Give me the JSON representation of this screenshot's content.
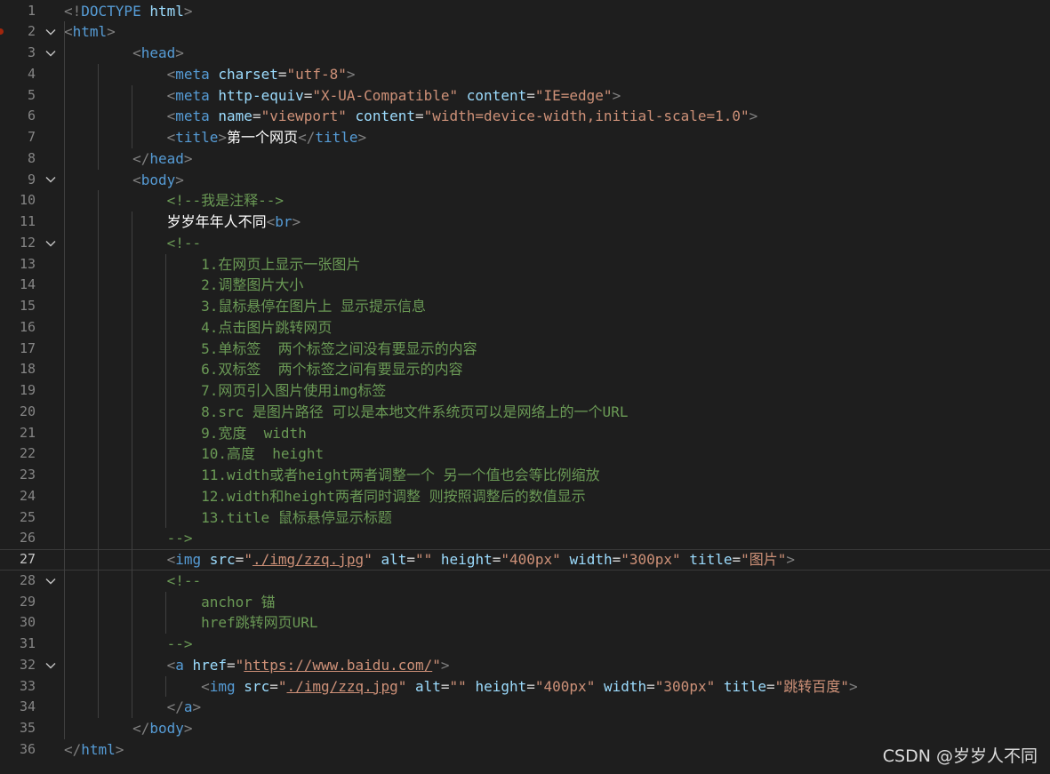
{
  "colors": {
    "background": "#1e1e1e",
    "line_number": "#858585",
    "active_line_number": "#c6c6c6",
    "punctuation": "#808080",
    "tag": "#569cd6",
    "attribute": "#9cdcfe",
    "string": "#ce9178",
    "comment": "#6a9955",
    "text": "#ffffff",
    "indent_guide": "#404040"
  },
  "editor": {
    "active_line": 27,
    "lines": [
      {
        "n": "1",
        "fold": false,
        "tokens": [
          [
            "p",
            "<!"
          ],
          [
            "t",
            "DOCTYPE "
          ],
          [
            "a",
            "html"
          ],
          [
            "p",
            ">"
          ]
        ]
      },
      {
        "n": "2",
        "fold": true,
        "tokens": [
          [
            "p",
            "<"
          ],
          [
            "t",
            "html"
          ],
          [
            "p",
            ">"
          ]
        ]
      },
      {
        "n": "3",
        "fold": true,
        "tokens": [
          [
            "w",
            "        "
          ],
          [
            "p",
            "<"
          ],
          [
            "t",
            "head"
          ],
          [
            "p",
            ">"
          ]
        ]
      },
      {
        "n": "4",
        "fold": false,
        "tokens": [
          [
            "w",
            "            "
          ],
          [
            "p",
            "<"
          ],
          [
            "t",
            "meta "
          ],
          [
            "a",
            "charset"
          ],
          [
            "w",
            "="
          ],
          [
            "s",
            "\"utf-8\""
          ],
          [
            "p",
            ">"
          ]
        ]
      },
      {
        "n": "5",
        "fold": false,
        "tokens": [
          [
            "w",
            "            "
          ],
          [
            "p",
            "<"
          ],
          [
            "t",
            "meta "
          ],
          [
            "a",
            "http-equiv"
          ],
          [
            "w",
            "="
          ],
          [
            "s",
            "\"X-UA-Compatible\""
          ],
          [
            "w",
            " "
          ],
          [
            "a",
            "content"
          ],
          [
            "w",
            "="
          ],
          [
            "s",
            "\"IE=edge\""
          ],
          [
            "p",
            ">"
          ]
        ]
      },
      {
        "n": "6",
        "fold": false,
        "tokens": [
          [
            "w",
            "            "
          ],
          [
            "p",
            "<"
          ],
          [
            "t",
            "meta "
          ],
          [
            "a",
            "name"
          ],
          [
            "w",
            "="
          ],
          [
            "s",
            "\"viewport\""
          ],
          [
            "w",
            " "
          ],
          [
            "a",
            "content"
          ],
          [
            "w",
            "="
          ],
          [
            "s",
            "\"width=device-width,initial-scale=1.0\""
          ],
          [
            "p",
            ">"
          ]
        ]
      },
      {
        "n": "7",
        "fold": false,
        "tokens": [
          [
            "w",
            "            "
          ],
          [
            "p",
            "<"
          ],
          [
            "t",
            "title"
          ],
          [
            "p",
            ">"
          ],
          [
            "x",
            "第一个网页"
          ],
          [
            "p",
            "</"
          ],
          [
            "t",
            "title"
          ],
          [
            "p",
            ">"
          ]
        ]
      },
      {
        "n": "8",
        "fold": false,
        "tokens": [
          [
            "w",
            "        "
          ],
          [
            "p",
            "</"
          ],
          [
            "t",
            "head"
          ],
          [
            "p",
            ">"
          ]
        ]
      },
      {
        "n": "9",
        "fold": true,
        "tokens": [
          [
            "w",
            "        "
          ],
          [
            "p",
            "<"
          ],
          [
            "t",
            "body"
          ],
          [
            "p",
            ">"
          ]
        ]
      },
      {
        "n": "10",
        "fold": false,
        "tokens": [
          [
            "w",
            "            "
          ],
          [
            "c",
            "<!--我是注释-->"
          ]
        ]
      },
      {
        "n": "11",
        "fold": false,
        "tokens": [
          [
            "w",
            "            "
          ],
          [
            "x",
            "岁岁年年人不同"
          ],
          [
            "p",
            "<"
          ],
          [
            "t",
            "br"
          ],
          [
            "p",
            ">"
          ]
        ]
      },
      {
        "n": "12",
        "fold": true,
        "tokens": [
          [
            "w",
            "            "
          ],
          [
            "c",
            "<!--"
          ]
        ]
      },
      {
        "n": "13",
        "fold": false,
        "tokens": [
          [
            "w",
            "                "
          ],
          [
            "c",
            "1.在网页上显示一张图片"
          ]
        ]
      },
      {
        "n": "14",
        "fold": false,
        "tokens": [
          [
            "w",
            "                "
          ],
          [
            "c",
            "2.调整图片大小"
          ]
        ]
      },
      {
        "n": "15",
        "fold": false,
        "tokens": [
          [
            "w",
            "                "
          ],
          [
            "c",
            "3.鼠标悬停在图片上 显示提示信息"
          ]
        ]
      },
      {
        "n": "16",
        "fold": false,
        "tokens": [
          [
            "w",
            "                "
          ],
          [
            "c",
            "4.点击图片跳转网页"
          ]
        ]
      },
      {
        "n": "17",
        "fold": false,
        "tokens": [
          [
            "w",
            "                "
          ],
          [
            "c",
            "5.单标签  两个标签之间没有要显示的内容"
          ]
        ]
      },
      {
        "n": "18",
        "fold": false,
        "tokens": [
          [
            "w",
            "                "
          ],
          [
            "c",
            "6.双标签  两个标签之间有要显示的内容"
          ]
        ]
      },
      {
        "n": "19",
        "fold": false,
        "tokens": [
          [
            "w",
            "                "
          ],
          [
            "c",
            "7.网页引入图片使用img标签"
          ]
        ]
      },
      {
        "n": "20",
        "fold": false,
        "tokens": [
          [
            "w",
            "                "
          ],
          [
            "c",
            "8.src 是图片路径 可以是本地文件系统页可以是网络上的一个URL"
          ]
        ]
      },
      {
        "n": "21",
        "fold": false,
        "tokens": [
          [
            "w",
            "                "
          ],
          [
            "c",
            "9.宽度  width"
          ]
        ]
      },
      {
        "n": "22",
        "fold": false,
        "tokens": [
          [
            "w",
            "                "
          ],
          [
            "c",
            "10.高度  height"
          ]
        ]
      },
      {
        "n": "23",
        "fold": false,
        "tokens": [
          [
            "w",
            "                "
          ],
          [
            "c",
            "11.width或者height两者调整一个 另一个值也会等比例缩放"
          ]
        ]
      },
      {
        "n": "24",
        "fold": false,
        "tokens": [
          [
            "w",
            "                "
          ],
          [
            "c",
            "12.width和height两者同时调整 则按照调整后的数值显示"
          ]
        ]
      },
      {
        "n": "25",
        "fold": false,
        "tokens": [
          [
            "w",
            "                "
          ],
          [
            "c",
            "13.title 鼠标悬停显示标题"
          ]
        ]
      },
      {
        "n": "26",
        "fold": false,
        "tokens": [
          [
            "w",
            "            "
          ],
          [
            "c",
            "-->"
          ]
        ]
      },
      {
        "n": "27",
        "fold": false,
        "tokens": [
          [
            "w",
            "            "
          ],
          [
            "p",
            "<"
          ],
          [
            "t",
            "img "
          ],
          [
            "a",
            "src"
          ],
          [
            "w",
            "="
          ],
          [
            "s",
            "\""
          ],
          [
            "u",
            "./img/zzq.jpg"
          ],
          [
            "s",
            "\""
          ],
          [
            "w",
            " "
          ],
          [
            "a",
            "alt"
          ],
          [
            "w",
            "="
          ],
          [
            "s",
            "\"\""
          ],
          [
            "w",
            " "
          ],
          [
            "a",
            "height"
          ],
          [
            "w",
            "="
          ],
          [
            "s",
            "\"400px\""
          ],
          [
            "w",
            " "
          ],
          [
            "a",
            "width"
          ],
          [
            "w",
            "="
          ],
          [
            "s",
            "\"300px\""
          ],
          [
            "w",
            " "
          ],
          [
            "a",
            "title"
          ],
          [
            "w",
            "="
          ],
          [
            "s",
            "\"图片\""
          ],
          [
            "p",
            ">"
          ]
        ]
      },
      {
        "n": "28",
        "fold": true,
        "tokens": [
          [
            "w",
            "            "
          ],
          [
            "c",
            "<!--"
          ]
        ]
      },
      {
        "n": "29",
        "fold": false,
        "tokens": [
          [
            "w",
            "                "
          ],
          [
            "c",
            "anchor 锚"
          ]
        ]
      },
      {
        "n": "30",
        "fold": false,
        "tokens": [
          [
            "w",
            "                "
          ],
          [
            "c",
            "href跳转网页URL"
          ]
        ]
      },
      {
        "n": "31",
        "fold": false,
        "tokens": [
          [
            "w",
            "            "
          ],
          [
            "c",
            "-->"
          ]
        ]
      },
      {
        "n": "32",
        "fold": true,
        "tokens": [
          [
            "w",
            "            "
          ],
          [
            "p",
            "<"
          ],
          [
            "t",
            "a "
          ],
          [
            "a",
            "href"
          ],
          [
            "w",
            "="
          ],
          [
            "s",
            "\""
          ],
          [
            "u",
            "https://www.baidu.com/"
          ],
          [
            "s",
            "\""
          ],
          [
            "p",
            ">"
          ]
        ]
      },
      {
        "n": "33",
        "fold": false,
        "tokens": [
          [
            "w",
            "                "
          ],
          [
            "p",
            "<"
          ],
          [
            "t",
            "img "
          ],
          [
            "a",
            "src"
          ],
          [
            "w",
            "="
          ],
          [
            "s",
            "\""
          ],
          [
            "u",
            "./img/zzq.jpg"
          ],
          [
            "s",
            "\""
          ],
          [
            "w",
            " "
          ],
          [
            "a",
            "alt"
          ],
          [
            "w",
            "="
          ],
          [
            "s",
            "\"\""
          ],
          [
            "w",
            " "
          ],
          [
            "a",
            "height"
          ],
          [
            "w",
            "="
          ],
          [
            "s",
            "\"400px\""
          ],
          [
            "w",
            " "
          ],
          [
            "a",
            "width"
          ],
          [
            "w",
            "="
          ],
          [
            "s",
            "\"300px\""
          ],
          [
            "w",
            " "
          ],
          [
            "a",
            "title"
          ],
          [
            "w",
            "="
          ],
          [
            "s",
            "\"跳转百度\""
          ],
          [
            "p",
            ">"
          ]
        ]
      },
      {
        "n": "34",
        "fold": false,
        "tokens": [
          [
            "w",
            "            "
          ],
          [
            "p",
            "</"
          ],
          [
            "t",
            "a"
          ],
          [
            "p",
            ">"
          ]
        ]
      },
      {
        "n": "35",
        "fold": false,
        "tokens": [
          [
            "w",
            "        "
          ],
          [
            "p",
            "</"
          ],
          [
            "t",
            "body"
          ],
          [
            "p",
            ">"
          ]
        ]
      },
      {
        "n": "36",
        "fold": false,
        "tokens": [
          [
            "p",
            "</"
          ],
          [
            "t",
            "html"
          ],
          [
            "p",
            ">"
          ]
        ]
      }
    ]
  },
  "watermark": "CSDN @岁岁人不同"
}
